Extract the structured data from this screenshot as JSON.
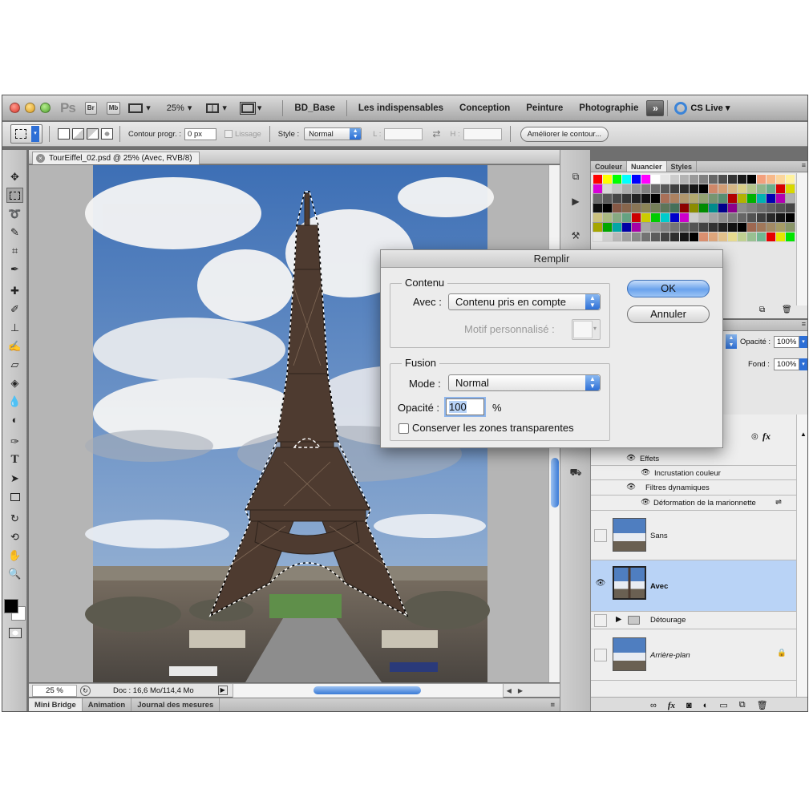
{
  "app": {
    "logo": "Ps",
    "br_label": "Br",
    "mb_label": "Mb",
    "zoom": "25%",
    "workspaces": [
      "BD_Base",
      "Les indispensables",
      "Conception",
      "Peinture",
      "Photographie"
    ],
    "cs_live": "CS Live"
  },
  "options": {
    "contour_label": "Contour progr. :",
    "contour_value": "0 px",
    "lissage_label": "Lissage",
    "style_label": "Style :",
    "style_value": "Normal",
    "l_label": "L :",
    "h_label": "H :",
    "refine_label": "Améliorer le contour..."
  },
  "document": {
    "tab_title": "TourEiffel_02.psd @ 25% (Avec, RVB/8)",
    "zoom_status": "25 %",
    "doc_size": "Doc : 16,6 Mo/114,4 Mo"
  },
  "bottom_tabs": [
    "Mini Bridge",
    "Animation",
    "Journal des mesures"
  ],
  "swatch_panel": {
    "tabs": [
      "Couleur",
      "Nuancier",
      "Styles"
    ],
    "colors": [
      "#ff0000",
      "#ffff00",
      "#00ff00",
      "#00ffff",
      "#0000ff",
      "#ff00ff",
      "#ffffff",
      "#e6e6e6",
      "#cccccc",
      "#b3b3b3",
      "#999999",
      "#808080",
      "#666666",
      "#4d4d4d",
      "#333333",
      "#1a1a1a",
      "#000000",
      "#f3a07d",
      "#f7b98a",
      "#fbd69c",
      "#fff29f",
      "#d4e7a1",
      "#a9d5a2",
      "#7ecba2"
    ]
  },
  "layers_panel": {
    "opacity_label": "Opacité :",
    "opacity_value": "100%",
    "fill_label": "Fond :",
    "fill_value": "100%",
    "effects_label": "Effets",
    "effect_item": "Incrustation couleur",
    "smart_filters_label": "Filtres dynamiques",
    "smart_filter_item": "Déformation de la marionnette",
    "layers": [
      {
        "name": "Sans",
        "visible": false
      },
      {
        "name": "Avec",
        "visible": true,
        "selected": true
      },
      {
        "name": "Détourage",
        "visible": false,
        "group": true
      },
      {
        "name": "Arrière-plan",
        "visible": false,
        "locked": true
      }
    ]
  },
  "dialog": {
    "title": "Remplir",
    "contents_group": "Contenu",
    "use_label": "Avec :",
    "use_value": "Contenu pris en compte",
    "custom_pattern_label": "Motif personnalisé :",
    "blending_group": "Fusion",
    "mode_label": "Mode :",
    "mode_value": "Normal",
    "opacity_label": "Opacité :",
    "opacity_value": "100",
    "percent": "%",
    "preserve_label": "Conserver les zones transparentes",
    "ok_label": "OK",
    "cancel_label": "Annuler"
  }
}
